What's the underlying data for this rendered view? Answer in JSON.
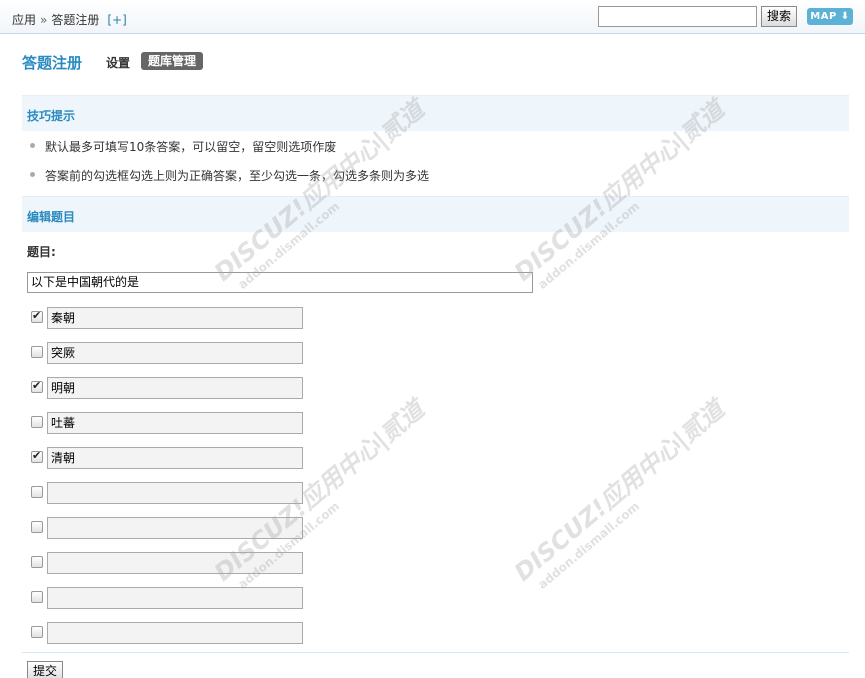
{
  "breadcrumb": {
    "root": "应用",
    "arrow": "»",
    "current": "答题注册",
    "add": "[+]"
  },
  "search": {
    "value": "",
    "button": "搜索"
  },
  "map_button": "MAP ⬇",
  "page": {
    "title": "答题注册",
    "tabs": [
      {
        "label": "设置",
        "active": false
      },
      {
        "label": "题库管理",
        "active": true
      }
    ]
  },
  "tips_section": {
    "header": "技巧提示",
    "items": [
      "默认最多可填写10条答案，可以留空，留空则选项作废",
      "答案前的勾选框勾选上则为正确答案，至少勾选一条，勾选多条则为多选"
    ]
  },
  "edit_section": {
    "header": "编辑题目",
    "question_label": "题目:",
    "question_value": "以下是中国朝代的是",
    "answers": [
      {
        "checked": true,
        "value": "秦朝"
      },
      {
        "checked": false,
        "value": "突厥"
      },
      {
        "checked": true,
        "value": "明朝"
      },
      {
        "checked": false,
        "value": "吐蕃"
      },
      {
        "checked": true,
        "value": "清朝"
      },
      {
        "checked": false,
        "value": ""
      },
      {
        "checked": false,
        "value": ""
      },
      {
        "checked": false,
        "value": ""
      },
      {
        "checked": false,
        "value": ""
      },
      {
        "checked": false,
        "value": ""
      }
    ],
    "submit": "提交"
  },
  "watermark": {
    "brand": "DISCUZ!应用中心|贰道",
    "url": "addon.dismall.com"
  },
  "colors": {
    "accent": "#2a8bc0",
    "section_bg": "#eef5fb",
    "map_btn": "#5cb2d6"
  }
}
